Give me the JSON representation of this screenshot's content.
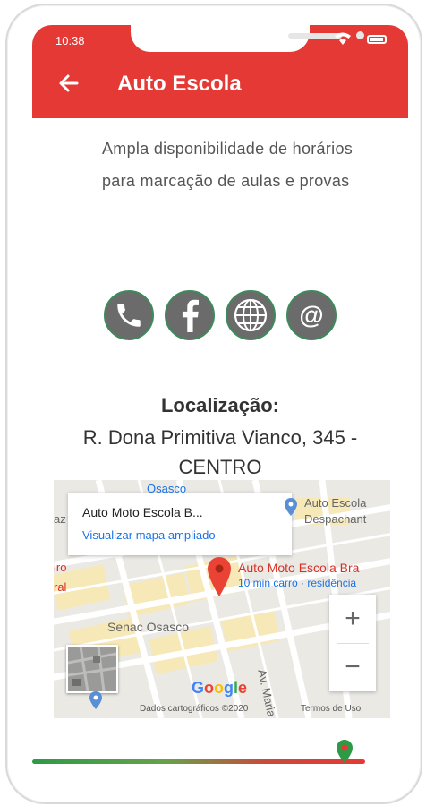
{
  "status_bar": {
    "time": "10:38"
  },
  "appbar": {
    "title": "Auto Escola"
  },
  "content": {
    "description": "Ampla disponibilidade de horários para marcação de aulas e provas",
    "contacts": [
      {
        "icon": "phone-icon"
      },
      {
        "icon": "facebook-icon"
      },
      {
        "icon": "globe-icon"
      },
      {
        "icon": "email-icon"
      }
    ],
    "location_title": "Localização:",
    "address_line1": "R. Dona Primitiva Vianco, 345 -",
    "address_line2": "CENTRO"
  },
  "map": {
    "info_card_title": "Auto Moto Escola B...",
    "info_card_link": "Visualizar mapa ampliado",
    "marker_label": "Auto Moto Escola Bra",
    "marker_sublabel": "10 min carro · residência",
    "poi_label_1": "Auto Escola",
    "poi_label_2": "Despachant",
    "area_label": "Senac Osasco",
    "street_label": "Av. Maria Camp",
    "top_label": "Osasco",
    "left_label_1": "az",
    "left_label_2": "iro",
    "left_label_3": "ral",
    "zoom_in": "+",
    "zoom_out": "−",
    "google_logo": "Google",
    "attribution": "Dados cartográficos ©2020",
    "terms": "Termos de Uso",
    "colors": {
      "accent": "#e53935",
      "ring": "#3d8a5a",
      "link": "#1a73e8"
    }
  }
}
